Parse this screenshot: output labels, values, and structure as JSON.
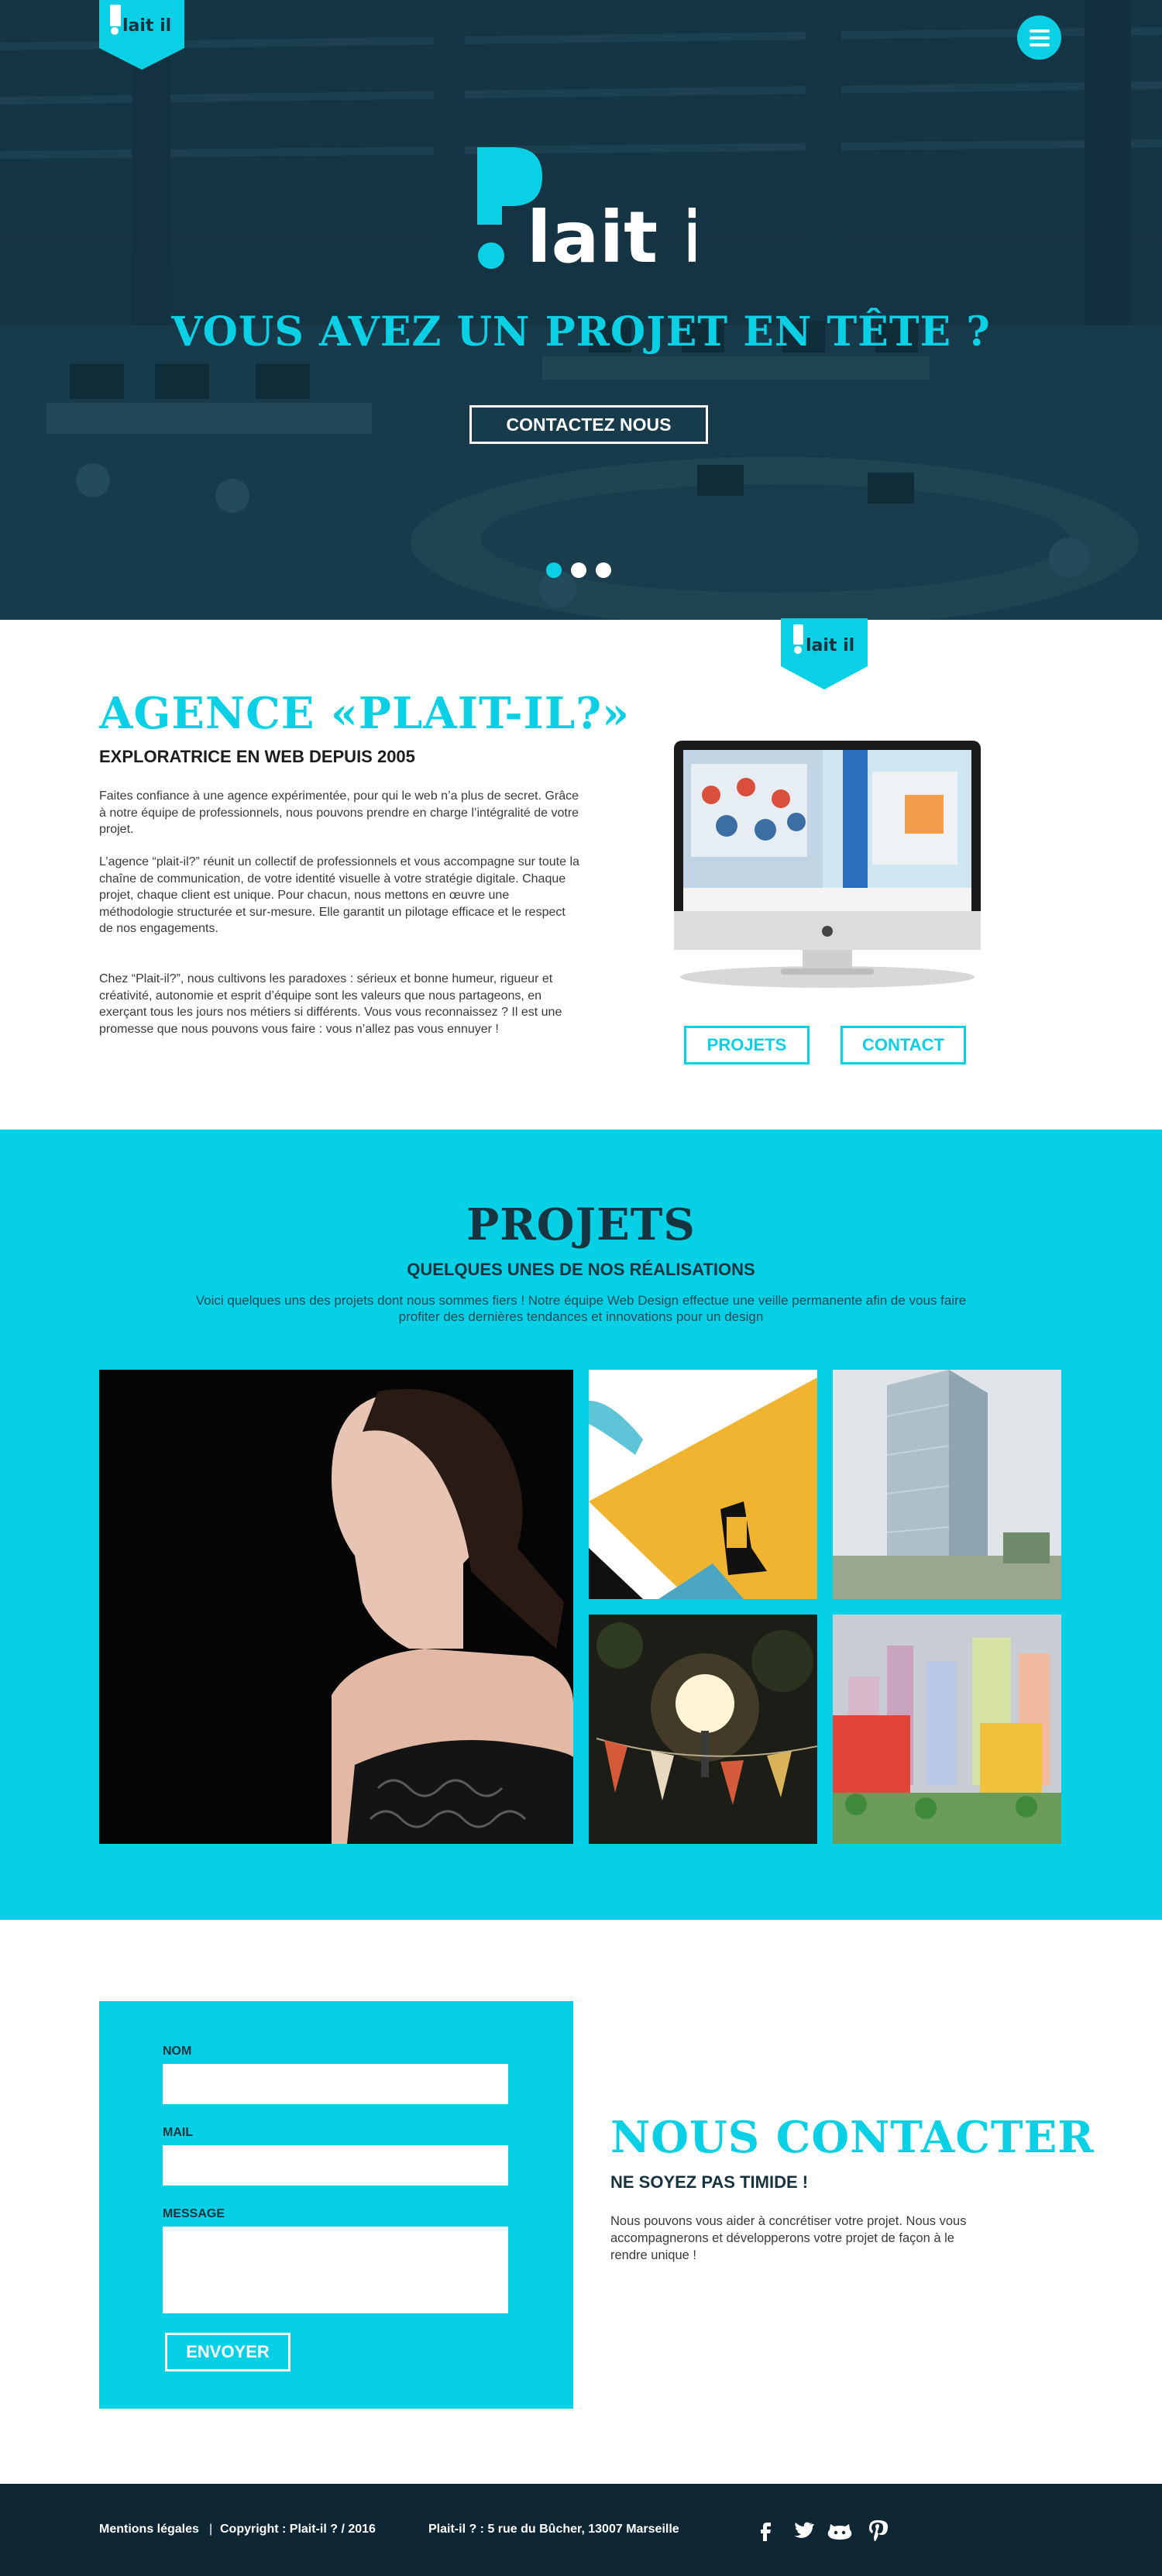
{
  "brand": {
    "logo_text": "Plait-il?",
    "accent": "#0ad0e6",
    "dark": "#17333f"
  },
  "hero": {
    "headline": "VOUS AVEZ UN PROJET EN TÊTE ?",
    "cta": "CONTACTEZ NOUS",
    "menu_icon": "hamburger-icon",
    "slides_count": 3,
    "active_slide": 1
  },
  "agence": {
    "title": "AGENCE «PLAIT-IL?»",
    "subtitle": "EXPLORATRICE EN WEB DEPUIS 2005",
    "paragraphs": [
      "Faites confiance à une agence expérimentée, pour qui le web n’a plus de secret. Grâce à notre équipe de professionnels, nous pouvons prendre en charge l’intégralité de votre projet.",
      "L’agence “plait-il?” réunit un collectif de professionnels et vous accompagne sur toute la chaîne de communication, de votre identité visuelle à votre stratégie digitale. Chaque projet, chaque client est unique. Pour chacun, nous mettons en œuvre une méthodologie structurée et sur-mesure. Elle garantit un pilotage efficace et le respect de nos engagements.",
      "Chez “Plait-il?”, nous cultivons les paradoxes : sérieux et bonne humeur, rigueur et créativité, autonomie et esprit d’équipe sont les valeurs que nous partageons, en exerçant tous les jours nos métiers si différents. Vous vous reconnaissez ? Il est une promesse que nous pouvons vous faire : vous n’allez pas vous ennuyer !"
    ],
    "btn_projets": "PROJETS",
    "btn_contact": "CONTACT"
  },
  "projets": {
    "title": "PROJETS",
    "subtitle": "QUELQUES UNES DE NOS RÉALISATIONS",
    "description": "Voici quelques uns des projets dont nous sommes fiers ! Notre équipe Web Design effectue une veille permanente afin de vous faire profiter des dernières tendances et innovations pour un design"
  },
  "contact": {
    "title": "NOUS CONTACTER",
    "subtitle": "NE SOYEZ PAS TIMIDE !",
    "text": "Nous pouvons vous aider à concrétiser votre projet. Nous vous accompagnerons et développerons votre projet de façon à le rendre unique !",
    "form": {
      "name_label": "NOM",
      "mail_label": "MAIL",
      "message_label": "MESSAGE",
      "name_value": "",
      "mail_value": "",
      "message_value": "",
      "submit": "ENVOYER"
    }
  },
  "footer": {
    "legal": "Mentions légales",
    "separator": "|",
    "copyright": "Copyright : Plait-il ? / 2016",
    "address": "Plait-il ? : 5 rue du Bûcher, 13007 Marseille",
    "social": [
      "facebook-icon",
      "twitter-icon",
      "github-icon",
      "pinterest-icon"
    ]
  }
}
